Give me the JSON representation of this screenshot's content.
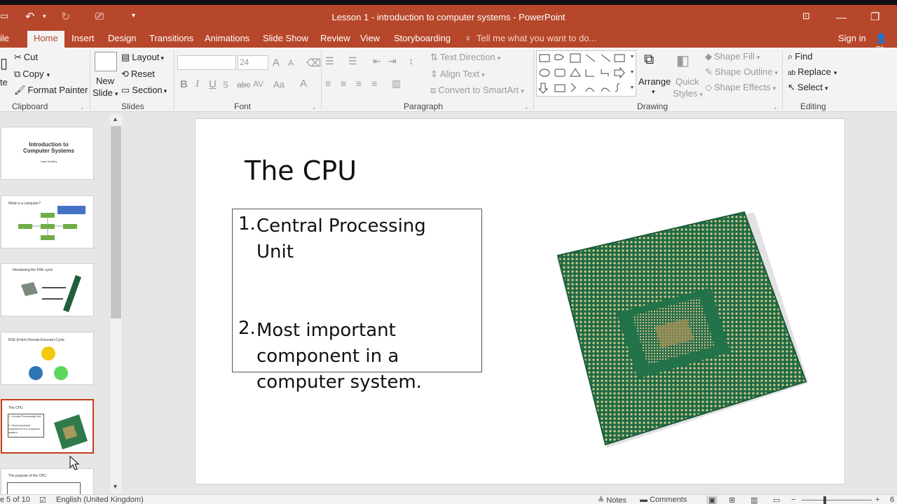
{
  "window": {
    "title": "Lesson 1 - introduction to computer systems - PowerPoint",
    "file_tab_partial": "ile",
    "sign_in": "Sign in",
    "share_partial": "Sh"
  },
  "tabs": [
    "Home",
    "Insert",
    "Design",
    "Transitions",
    "Animations",
    "Slide Show",
    "Review",
    "View",
    "Storyboarding"
  ],
  "tell_me": "Tell me what you want to do...",
  "ribbon": {
    "clipboard": {
      "label": "Clipboard",
      "paste_partial": "te",
      "cut": "Cut",
      "copy": "Copy",
      "format_painter": "Format Painter"
    },
    "slides": {
      "label": "Slides",
      "new_slide_line1": "New",
      "new_slide_line2": "Slide",
      "layout": "Layout",
      "reset": "Reset",
      "section": "Section"
    },
    "font": {
      "label": "Font",
      "font_name": "",
      "font_size": "24",
      "grow": "A",
      "shrink": "A",
      "bold": "B",
      "italic": "I",
      "underline": "U",
      "strike": "abc",
      "spacing": "AV",
      "case": "Aa",
      "color": "A"
    },
    "paragraph": {
      "label": "Paragraph",
      "text_direction": "Text Direction",
      "align_text": "Align Text",
      "convert_smartart": "Convert to SmartArt"
    },
    "drawing": {
      "label": "Drawing",
      "arrange": "Arrange",
      "quick_line1": "Quick",
      "quick_line2": "Styles",
      "shape_fill": "Shape Fill",
      "shape_outline": "Shape Outline",
      "shape_effects": "Shape Effects"
    },
    "editing": {
      "label": "Editing",
      "find": "Find",
      "replace": "Replace",
      "select": "Select"
    }
  },
  "thumbnails": [
    {
      "title": "Introduction to Computer Systems",
      "sub": "Liam Smalley"
    },
    {
      "title": "What is a computer?"
    },
    {
      "title": "Introducing the FDE cycle"
    },
    {
      "title": "FDE (Fetch-Decode-Execute) Cycle"
    },
    {
      "title": "The CPU",
      "item1": "1. Central Processing Unit",
      "item2": "2. Most important component in a computer system."
    },
    {
      "title": "The purpose of the CPU"
    }
  ],
  "slide": {
    "title": "The CPU",
    "items": [
      {
        "num": "1.",
        "text": "Central Processing Unit"
      },
      {
        "num": "2.",
        "text": "Most important component in a computer system."
      }
    ]
  },
  "status": {
    "slide_counter_partial": "e 5 of 10",
    "language": "English (United Kingdom)",
    "notes": "Notes",
    "comments": "Comments",
    "zoom_partial": "6"
  },
  "colors": {
    "accent": "#b7472a",
    "selection": "#c43e1c",
    "cpu_green": "#1d6b45"
  }
}
